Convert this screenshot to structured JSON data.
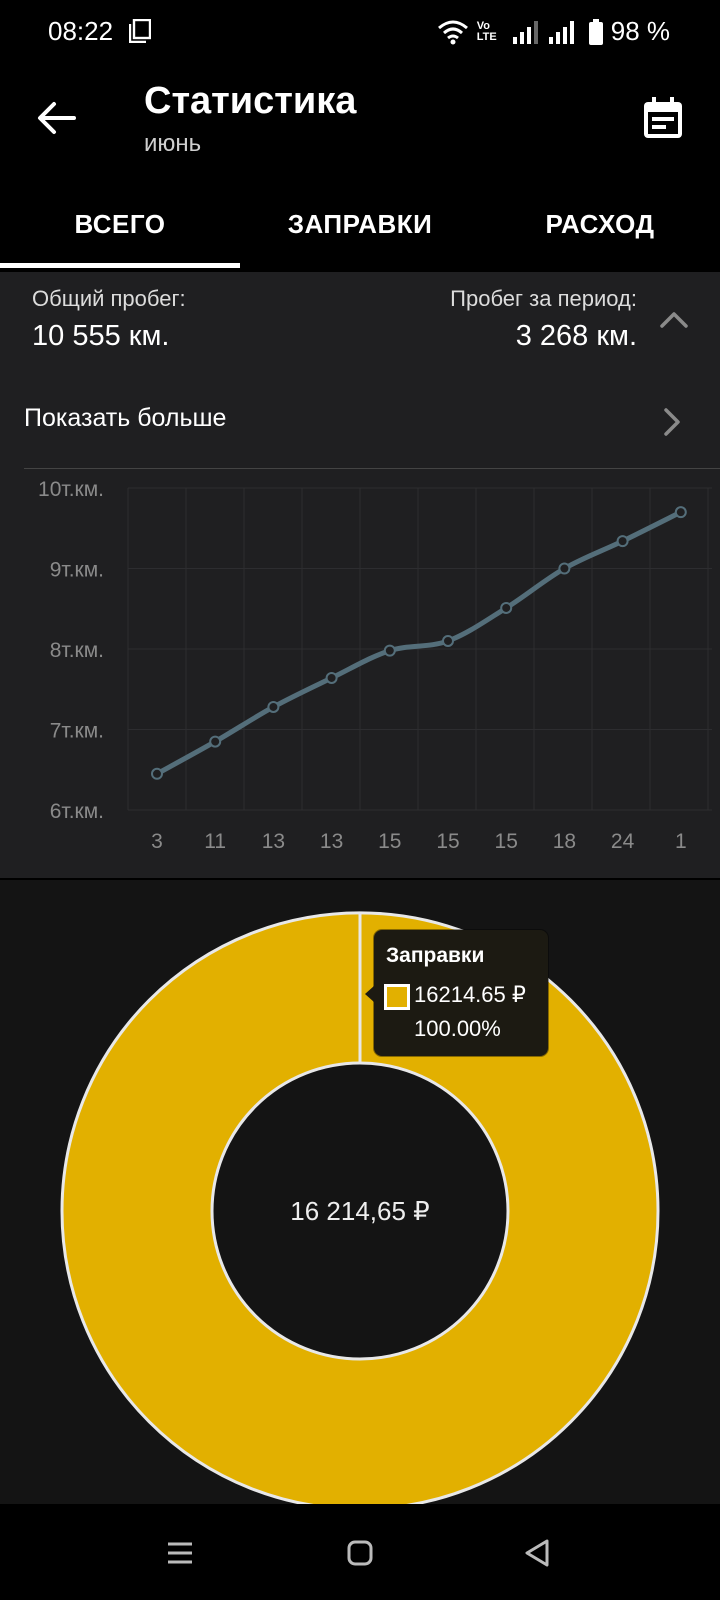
{
  "status_bar": {
    "time": "08:22",
    "network": "Vo LTE",
    "battery": "98 %"
  },
  "app_bar": {
    "title": "Статистика",
    "subtitle": "июнь",
    "back_icon": "arrow-left-icon",
    "calendar_icon": "calendar-icon"
  },
  "tabs": [
    {
      "label": "ВСЕГО",
      "active": true
    },
    {
      "label": "ЗАПРАВКИ",
      "active": false
    },
    {
      "label": "РАСХОД",
      "active": false
    }
  ],
  "summary": {
    "total_label": "Общий пробег:",
    "total_value": "10 555 км.",
    "period_label": "Пробег за период:",
    "period_value": "3 268 км.",
    "show_more": "Показать больше"
  },
  "colors": {
    "line": "#546e7a",
    "donut": "#e2b000",
    "panel": "#1f1f21",
    "donut_bg": "#141414"
  },
  "chart_data": {
    "type": "line",
    "x_labels": [
      "3",
      "11",
      "13",
      "13",
      "15",
      "15",
      "15",
      "18",
      "24",
      "1"
    ],
    "y_ticks": [
      "6т.км.",
      "7т.км.",
      "8т.км.",
      "9т.км.",
      "10т.км."
    ],
    "ylim": [
      6000,
      10000
    ],
    "grid": true,
    "series": [
      {
        "values": [
          6450,
          6850,
          7280,
          7640,
          7980,
          8100,
          8510,
          9000,
          9340,
          9700
        ]
      }
    ]
  },
  "donut": {
    "center_label": "16 214,65 ₽",
    "tooltip_title": "Заправки",
    "tooltip_value": "16214.65 ₽",
    "tooltip_percent": "100.00%",
    "fraction": 1.0
  }
}
